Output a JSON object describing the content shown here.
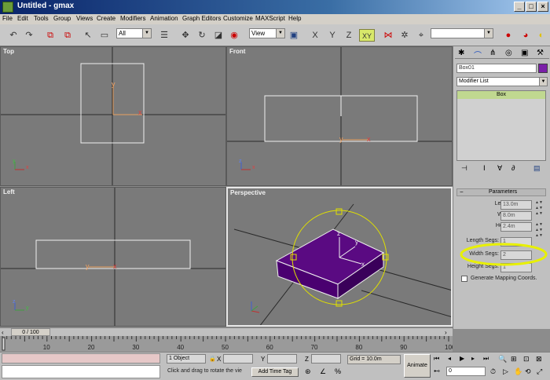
{
  "window": {
    "title": "Untitled - gmax"
  },
  "menu": [
    "File",
    "Edit",
    "Tools",
    "Group",
    "Views",
    "Create",
    "Modifiers",
    "Animation",
    "Graph Editors",
    "Customize",
    "MAXScript",
    "Help"
  ],
  "toolbar": {
    "selection_filter": "All",
    "ref_coord": "View",
    "constraint_xy": "XY",
    "axis_x": "X",
    "axis_y": "Y",
    "axis_z": "Z",
    "named_selection": ""
  },
  "viewports": {
    "top": "Top",
    "front": "Front",
    "left": "Left",
    "perspective": "Perspective",
    "axis_x": "x",
    "axis_y": "y",
    "axis_z": "z"
  },
  "panel": {
    "object_name": "Box01",
    "object_color": "#7a1fa8",
    "modifier_list": "Modifier List",
    "stack_item": "Box",
    "rollout_title": "Parameters",
    "length_label": "Length:",
    "length_value": "13.0m",
    "width_label": "Width:",
    "width_value": "8.0m",
    "height_label": "Height:",
    "height_value": "2.4m",
    "length_segs_label": "Length Segs:",
    "length_segs_value": "1",
    "width_segs_label": "Width Segs:",
    "width_segs_value": "2",
    "height_segs_label": "Height Segs:",
    "height_segs_value": "1",
    "mapping_label": "Generate Mapping Coords."
  },
  "timeline": {
    "frame": "0 / 100",
    "ticks": [
      "10",
      "20",
      "30",
      "40",
      "50",
      "60",
      "70",
      "80",
      "90",
      "100"
    ]
  },
  "status": {
    "selection": "1 Object",
    "prompt": "Click and drag to rotate the vie",
    "add_time_tag": "Add Time Tag",
    "x_label": "X",
    "y_label": "Y",
    "z_label": "Z",
    "grid": "Grid = 10.0m",
    "animate": "Animate",
    "frame_field": "0"
  },
  "colors": {
    "highlight": "#e8f000",
    "box_purple": "#5a0a82",
    "gizmo": "#e0e000"
  }
}
